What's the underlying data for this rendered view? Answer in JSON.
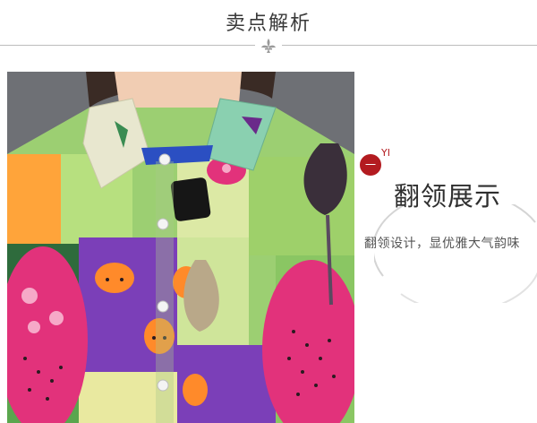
{
  "header": {
    "title": "卖点解析"
  },
  "feature": {
    "badge": "一",
    "badge_sub": "YI",
    "title": "翻领展示",
    "description": "翻领设计，显优雅大气韵味"
  },
  "colors": {
    "accent": "#b31b20",
    "divider": "#bdbdbd",
    "shirt_green": "#8fcf6a",
    "shirt_purple": "#7a3fb8",
    "shirt_pink": "#e0317a"
  }
}
